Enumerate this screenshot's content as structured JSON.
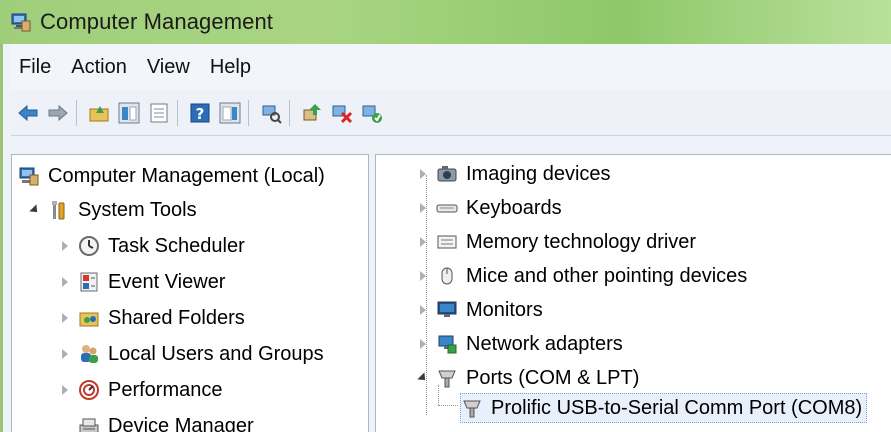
{
  "window": {
    "title": "Computer Management"
  },
  "menu": [
    "File",
    "Action",
    "View",
    "Help"
  ],
  "toolbar": {
    "buttons": [
      "back-arrow-icon",
      "forward-arrow-icon",
      "up-folder-icon",
      "show-hide-console-tree-icon",
      "properties-icon",
      "help-icon",
      "show-hide-action-pane-icon",
      "scan-hardware-icon",
      "update-driver-icon",
      "disable-device-icon",
      "uninstall-device-icon"
    ]
  },
  "left_tree": {
    "root": "Computer Management (Local)",
    "system_tools": "System Tools",
    "items": [
      {
        "label": "Task Scheduler",
        "icon": "clock-icon"
      },
      {
        "label": "Event Viewer",
        "icon": "event-viewer-icon"
      },
      {
        "label": "Shared Folders",
        "icon": "shared-folder-icon"
      },
      {
        "label": "Local Users and Groups",
        "icon": "users-icon"
      },
      {
        "label": "Performance",
        "icon": "performance-icon"
      }
    ],
    "device_manager": "Device Manager"
  },
  "right_tree": {
    "items": [
      {
        "label": "Imaging devices",
        "icon": "camera-icon"
      },
      {
        "label": "Keyboards",
        "icon": "keyboard-icon"
      },
      {
        "label": "Memory technology driver",
        "icon": "memory-icon"
      },
      {
        "label": "Mice and other pointing devices",
        "icon": "mouse-icon"
      },
      {
        "label": "Monitors",
        "icon": "monitor-icon"
      },
      {
        "label": "Network adapters",
        "icon": "network-adapter-icon"
      }
    ],
    "ports": "Ports (COM & LPT)",
    "port_child": "Prolific USB-to-Serial Comm Port (COM8)"
  },
  "colors": {
    "titlebar": "#a9d583",
    "selection": "#e8f0fb",
    "selection_border": "#7da2ce"
  }
}
